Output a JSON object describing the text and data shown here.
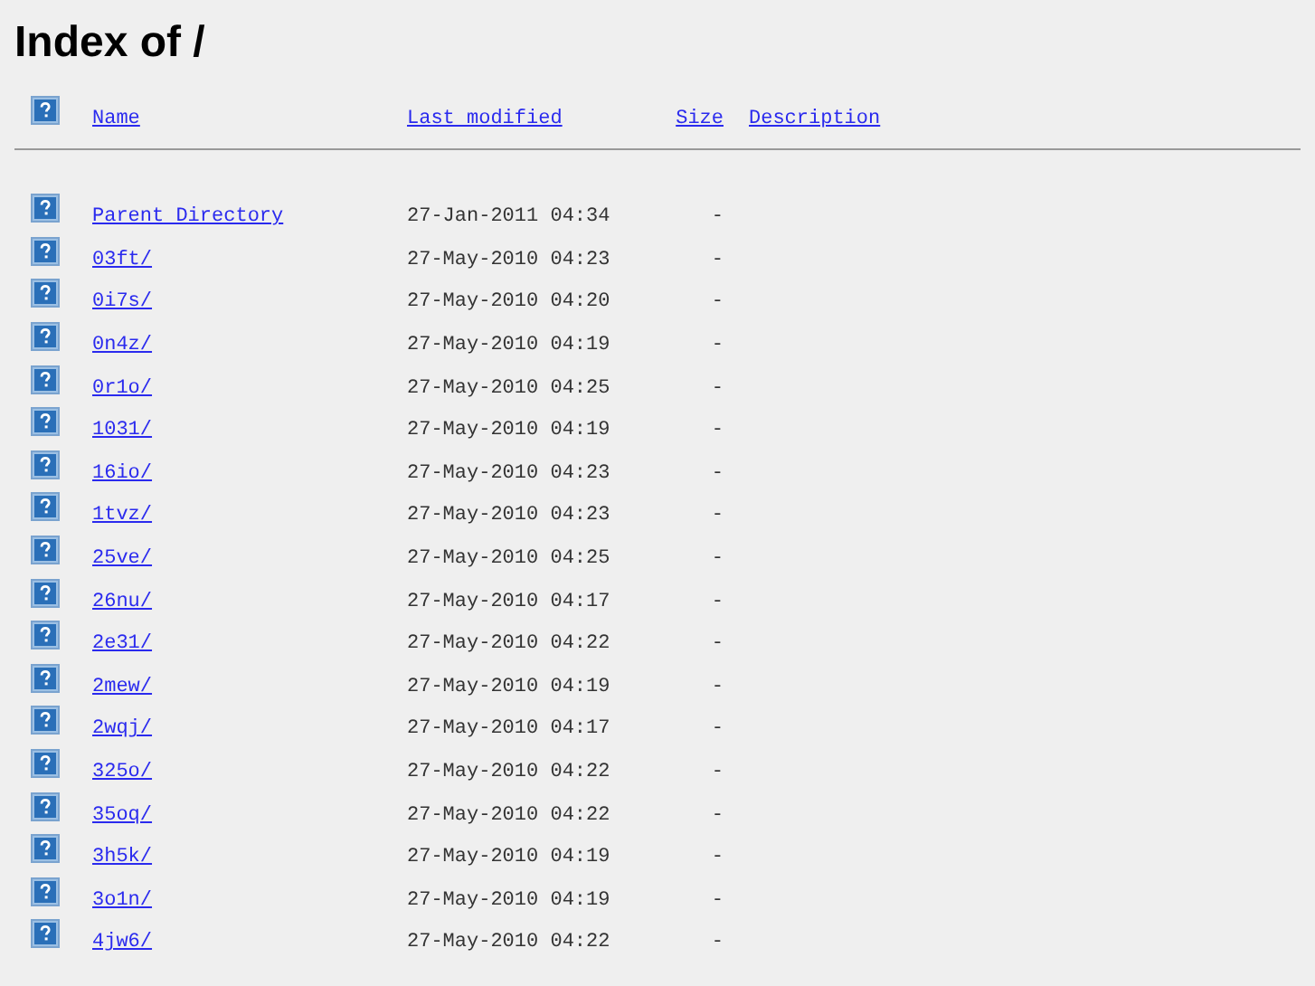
{
  "title": "Index of /",
  "columns": [
    "Name",
    "Last modified",
    "Size",
    "Description"
  ],
  "rows": [
    {
      "name": "Parent Directory",
      "modified": "27-Jan-2011 04:34",
      "size": "-"
    },
    {
      "name": "03ft/",
      "modified": "27-May-2010 04:23",
      "size": "-"
    },
    {
      "name": "0i7s/",
      "modified": "27-May-2010 04:20",
      "size": "-"
    },
    {
      "name": "0n4z/",
      "modified": "27-May-2010 04:19",
      "size": "-"
    },
    {
      "name": "0r1o/",
      "modified": "27-May-2010 04:25",
      "size": "-"
    },
    {
      "name": "1031/",
      "modified": "27-May-2010 04:19",
      "size": "-"
    },
    {
      "name": "16io/",
      "modified": "27-May-2010 04:23",
      "size": "-"
    },
    {
      "name": "1tvz/",
      "modified": "27-May-2010 04:23",
      "size": "-"
    },
    {
      "name": "25ve/",
      "modified": "27-May-2010 04:25",
      "size": "-"
    },
    {
      "name": "26nu/",
      "modified": "27-May-2010 04:17",
      "size": "-"
    },
    {
      "name": "2e31/",
      "modified": "27-May-2010 04:22",
      "size": "-"
    },
    {
      "name": "2mew/",
      "modified": "27-May-2010 04:19",
      "size": "-"
    },
    {
      "name": "2wqj/",
      "modified": "27-May-2010 04:17",
      "size": "-"
    },
    {
      "name": "325o/",
      "modified": "27-May-2010 04:22",
      "size": "-"
    },
    {
      "name": "35oq/",
      "modified": "27-May-2010 04:22",
      "size": "-"
    },
    {
      "name": "3h5k/",
      "modified": "27-May-2010 04:19",
      "size": "-"
    },
    {
      "name": "3o1n/",
      "modified": "27-May-2010 04:19",
      "size": "-"
    },
    {
      "name": "4jw6/",
      "modified": "27-May-2010 04:22",
      "size": "-"
    }
  ]
}
